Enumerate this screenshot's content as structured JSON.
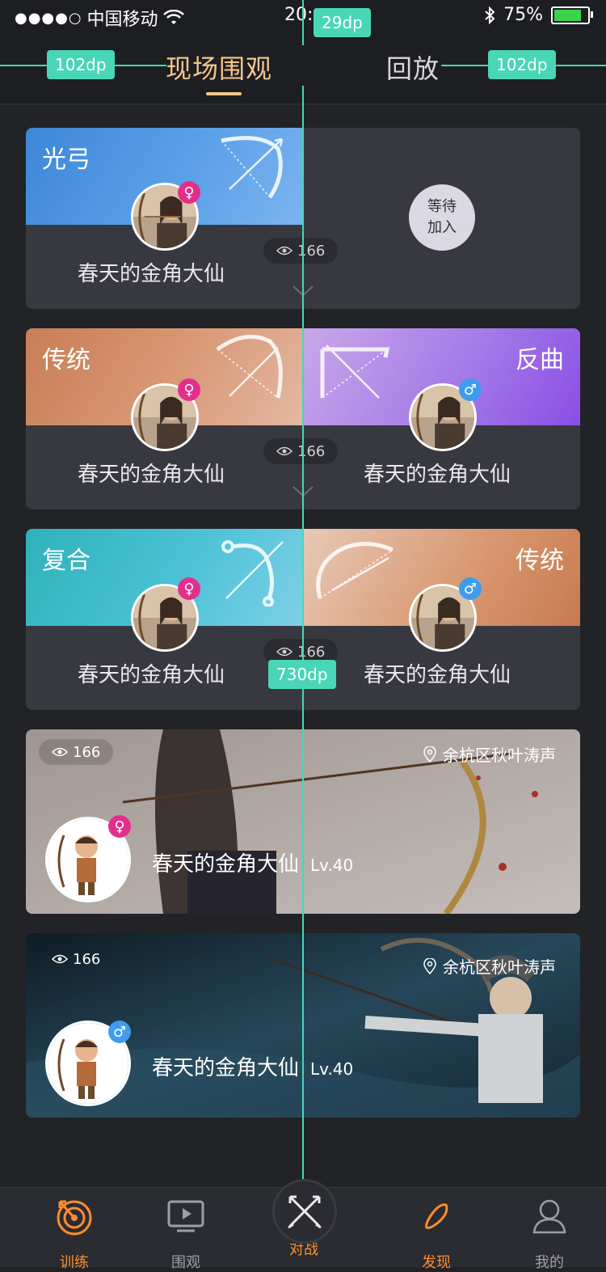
{
  "status_bar": {
    "signal_dots": "●●●●○",
    "carrier": "中国移动",
    "time": "20:",
    "battery": "75%"
  },
  "tabs": {
    "live": "现场围观",
    "replay": "回放"
  },
  "annotations": {
    "left_margin": "102dp",
    "right_margin": "102dp",
    "top_height": "29dp",
    "card_width": "730dp"
  },
  "cards": [
    {
      "left_category": "光弓",
      "right_category": "",
      "left_name": "春天的金角大仙",
      "views": "166",
      "waiting_line1": "等待",
      "waiting_line2": "加入"
    },
    {
      "left_category": "传统",
      "right_category": "反曲",
      "left_name": "春天的金角大仙",
      "right_name": "春天的金角大仙",
      "views": "166"
    },
    {
      "left_category": "复合",
      "right_category": "传统",
      "left_name": "春天的金角大仙",
      "right_name": "春天的金角大仙",
      "views": "166"
    }
  ],
  "photo_cards": [
    {
      "views": "166",
      "location": "余杭区秋叶涛声",
      "name": "春天的金角大仙",
      "level": "Lv.40"
    },
    {
      "views": "166",
      "location": "余杭区秋叶涛声",
      "name": "春天的金角大仙",
      "level": "Lv.40"
    }
  ],
  "bottom_nav": [
    {
      "label": "训练",
      "icon": "target-icon"
    },
    {
      "label": "围观",
      "icon": "play-icon"
    },
    {
      "label": "对战",
      "icon": "crossed-arrows-icon"
    },
    {
      "label": "发现",
      "icon": "compass-icon"
    },
    {
      "label": "我的",
      "icon": "profile-icon"
    }
  ],
  "colors": {
    "accent": "#f5c58f",
    "nav_active": "#ff8d2c",
    "female": "#e32f8c",
    "male": "#3d9cf0",
    "annotation": "#49d6b6"
  }
}
